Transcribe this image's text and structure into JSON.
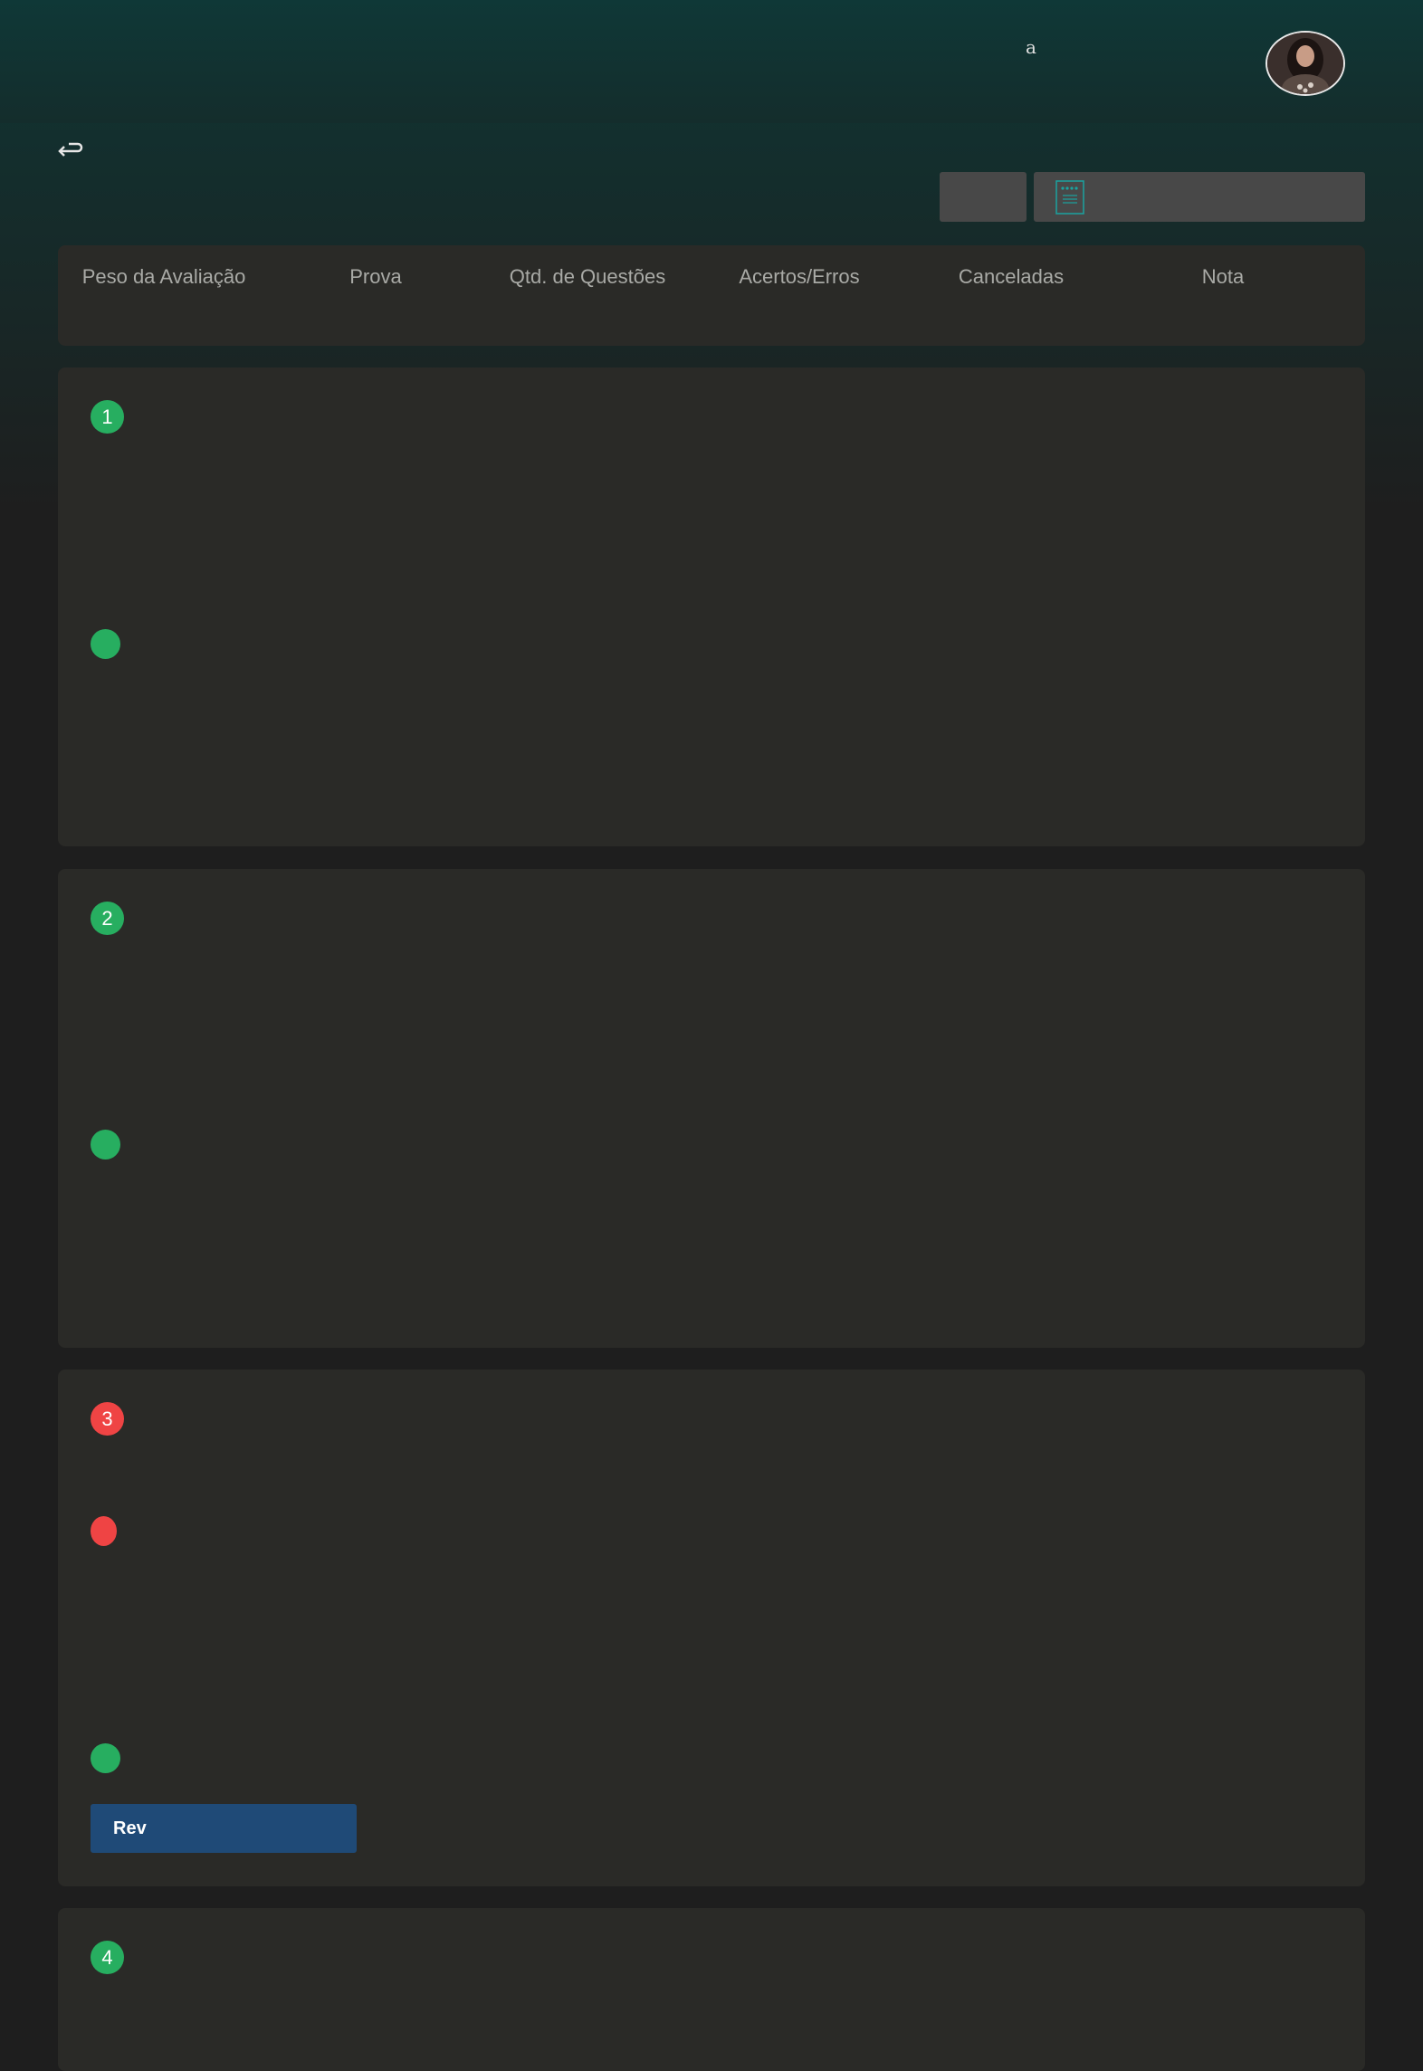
{
  "topbar": {
    "text": "a"
  },
  "header": {
    "columns": [
      "Peso da Avaliação",
      "Prova",
      "Qtd. de Questões",
      "Acertos/Erros",
      "Canceladas",
      "Nota"
    ]
  },
  "questions": [
    {
      "number": "1",
      "status": "correct"
    },
    {
      "number": "2",
      "status": "correct"
    },
    {
      "number": "3",
      "status": "incorrect",
      "button_label": "Rev"
    },
    {
      "number": "4",
      "status": "correct"
    }
  ],
  "colors": {
    "correct": "#27ae60",
    "incorrect": "#ef4444",
    "accent": "#1f4a77"
  }
}
